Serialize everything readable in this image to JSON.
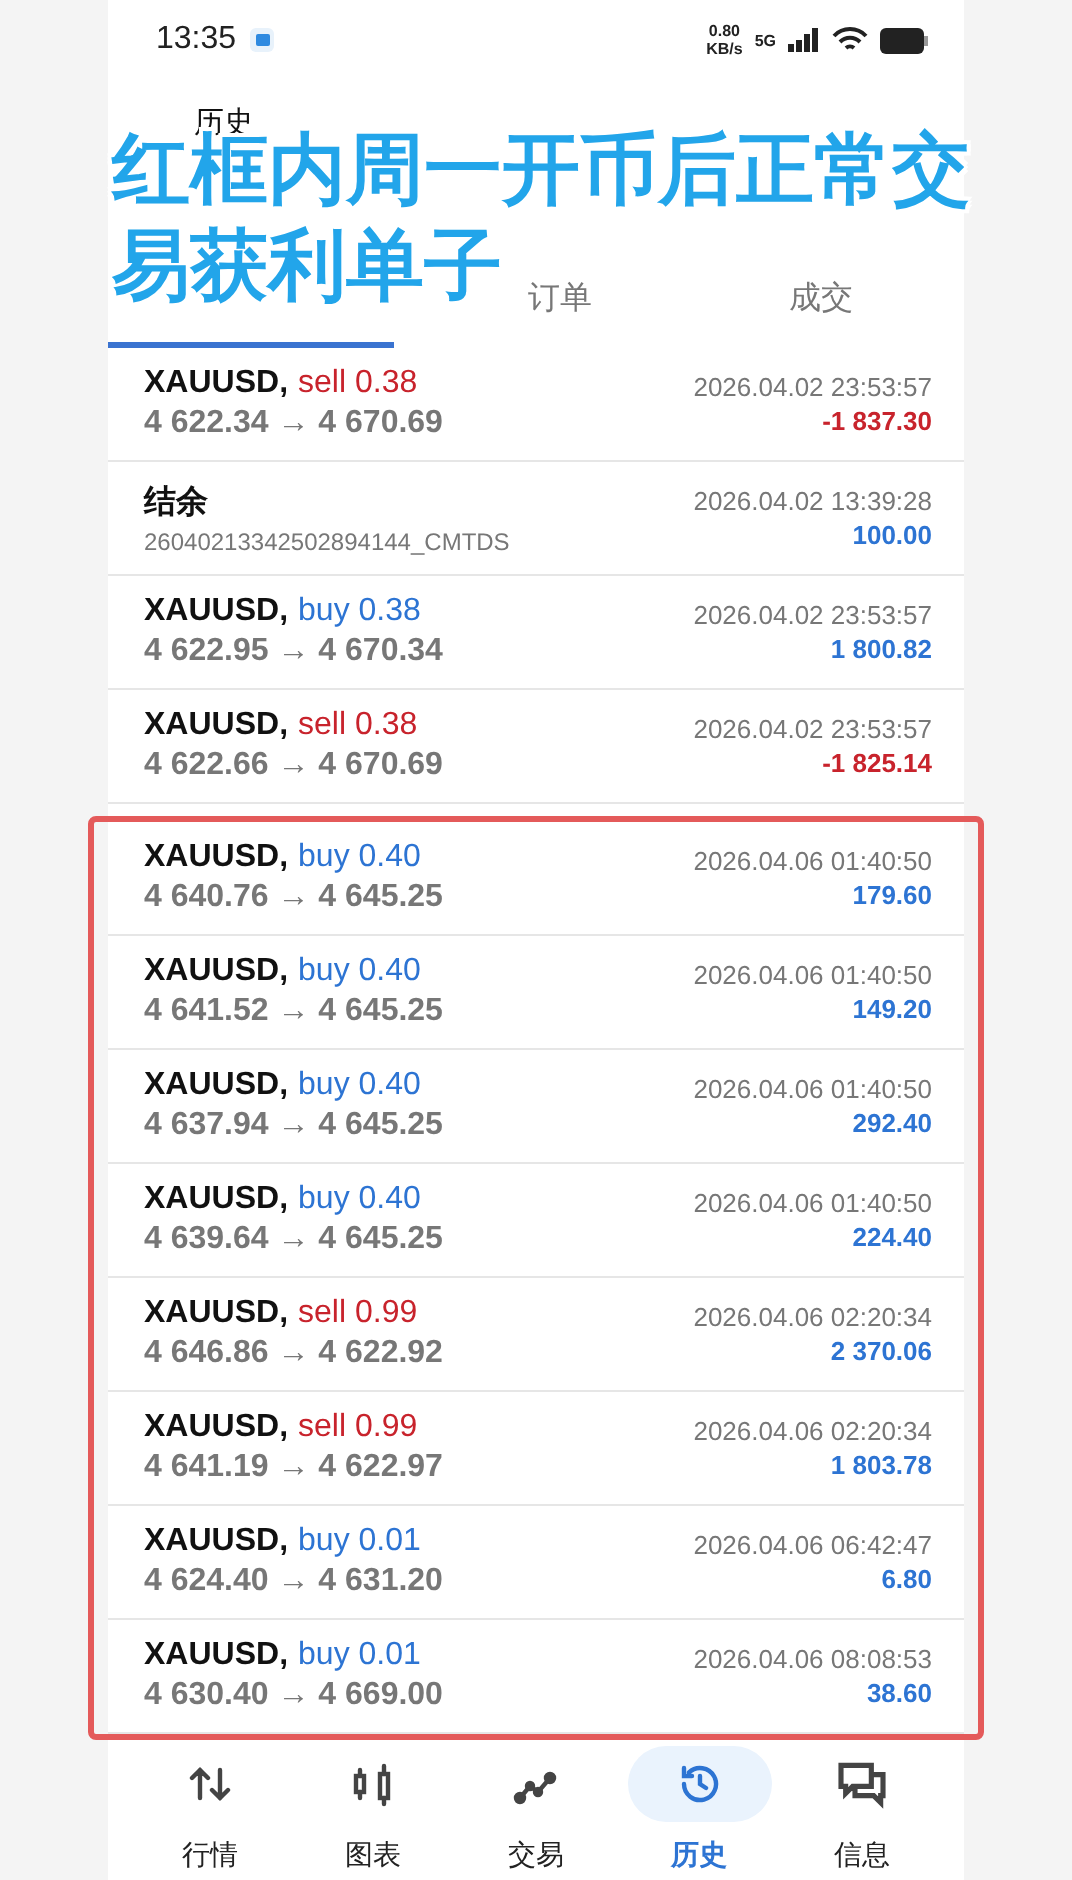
{
  "status_bar": {
    "time": "13:35",
    "speed": "0.80",
    "speed_unit": "KB/s",
    "network": "5G"
  },
  "header": {
    "title": "历史"
  },
  "tabs": [
    {
      "selected": true
    },
    {
      "label": "订单",
      "selected": false
    },
    {
      "label": "成交",
      "selected": false
    }
  ],
  "rows": [
    {
      "kind": "deal",
      "symbol": "XAUUSD,",
      "volume": "sell 0.38",
      "color": "#c8232c",
      "prices": "4 622.34 → 4 670.69",
      "time": "2026.04.02 23:53:57",
      "profit": "-1 837.30"
    },
    {
      "kind": "balance",
      "symbol": "结余",
      "prices": "26040213342502894144_CMTDS",
      "time": "2026.04.02 13:39:28",
      "profit": "100.00"
    },
    {
      "kind": "deal",
      "symbol": "XAUUSD,",
      "volume": "buy 0.38",
      "color": "#2d74d3",
      "prices": "4 622.95 → 4 670.34",
      "time": "2026.04.02 23:53:57",
      "profit": "1 800.82"
    },
    {
      "kind": "deal",
      "symbol": "XAUUSD,",
      "volume": "sell 0.38",
      "color": "#c8232c",
      "prices": "4 622.66 → 4 670.69",
      "time": "2026.04.02 23:53:57",
      "profit": "-1 825.14"
    }
  ],
  "annotation": {
    "caption_lines": [
      "红框内周一开币后正常交",
      "易获利单子"
    ],
    "rows": [
      {
        "kind": "deal",
        "symbol": "XAUUSD,",
        "volume": "buy 0.40",
        "color": "#2d74d3",
        "prices": "4 640.76 → 4 645.25",
        "time": "2026.04.06 01:40:50",
        "profit": "179.60"
      },
      {
        "kind": "deal",
        "symbol": "XAUUSD,",
        "volume": "buy 0.40",
        "color": "#2d74d3",
        "prices": "4 641.52 → 4 645.25",
        "time": "2026.04.06 01:40:50",
        "profit": "149.20"
      },
      {
        "kind": "deal",
        "symbol": "XAUUSD,",
        "volume": "buy 0.40",
        "color": "#2d74d3",
        "prices": "4 637.94 → 4 645.25",
        "time": "2026.04.06 01:40:50",
        "profit": "292.40"
      },
      {
        "kind": "deal",
        "symbol": "XAUUSD,",
        "volume": "buy 0.40",
        "color": "#2d74d3",
        "prices": "4 639.64 → 4 645.25",
        "time": "2026.04.06 01:40:50",
        "profit": "224.40"
      },
      {
        "kind": "deal",
        "symbol": "XAUUSD,",
        "volume": "sell 0.99",
        "color": "#c8232c",
        "prices": "4 646.86 → 4 622.92",
        "time": "2026.04.06 02:20:34",
        "profit": "2 370.06"
      },
      {
        "kind": "deal",
        "symbol": "XAUUSD,",
        "volume": "sell 0.99",
        "color": "#c8232c",
        "prices": "4 641.19 → 4 622.97",
        "time": "2026.04.06 02:20:34",
        "profit": "1 803.78"
      },
      {
        "kind": "deal",
        "symbol": "XAUUSD,",
        "volume": "buy 0.01",
        "color": "#2d74d3",
        "prices": "4 624.40 → 4 631.20",
        "time": "2026.04.06 06:42:47",
        "profit": "6.80"
      },
      {
        "kind": "deal",
        "symbol": "XAUUSD,",
        "volume": "buy 0.01",
        "color": "#2d74d3",
        "prices": "4 630.40 → 4 669.00",
        "time": "2026.04.06 08:08:53",
        "profit": "38.60"
      }
    ]
  },
  "bottom_nav": [
    {
      "kind": "quotes",
      "label": "行情",
      "selected": false
    },
    {
      "kind": "chart",
      "label": "图表",
      "selected": false
    },
    {
      "kind": "trade",
      "label": "交易",
      "selected": false
    },
    {
      "kind": "history",
      "label": "历史",
      "selected": true
    },
    {
      "kind": "messages",
      "label": "信息",
      "selected": false
    }
  ]
}
